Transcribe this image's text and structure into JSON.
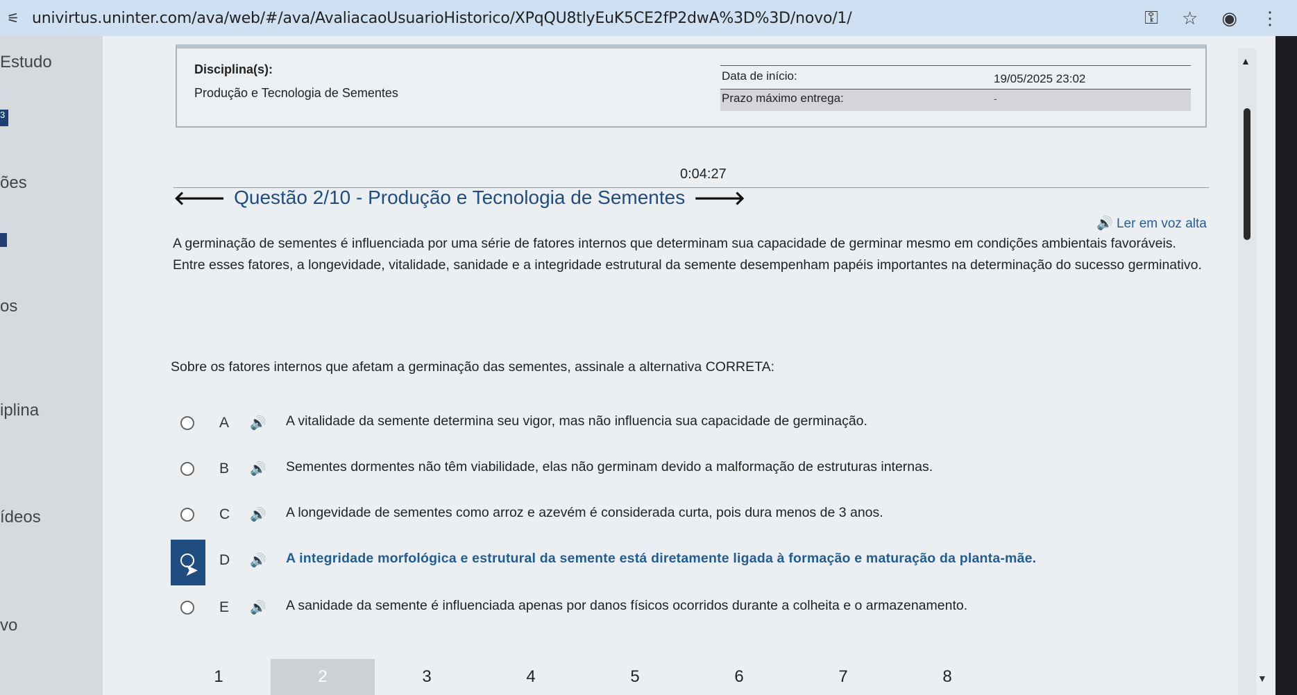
{
  "browser": {
    "url": "univirtus.uninter.com/ava/web/#/ava/AvaliacaoUsuarioHistorico/XPqQU8tlyEuK5CE2fP2dwA%3D%3D/novo/1/",
    "icons": [
      "key-icon",
      "star-icon",
      "profile-icon",
      "more-vert-icon"
    ]
  },
  "sidebar": {
    "items": [
      "Estudo",
      "ões",
      "os",
      "iplina",
      "ídeos",
      "vo"
    ],
    "badge": "3"
  },
  "info": {
    "discipline_label": "Disciplina(s):",
    "discipline_value": "Produção e Tecnologia de Sementes",
    "start_label": "Data de início:",
    "start_value": "19/05/2025 23:02",
    "due_label": "Prazo máximo entrega:",
    "due_value": "-"
  },
  "timer": "0:04:27",
  "question": {
    "title": "Questão 2/10 - Produção e Tecnologia de Sementes",
    "read_aloud": "Ler em voz alta",
    "stem": "A germinação de sementes é influenciada por uma série de fatores internos que determinam sua capacidade de germinar mesmo em condições ambientais favoráveis. Entre esses fatores, a longevidade, vitalidade, sanidade e a integridade estrutural da semente desempenham papéis importantes na determinação do sucesso germinativo.",
    "prompt": "Sobre os fatores internos que afetam a germinação das sementes, assinale a alternativa CORRETA:",
    "options": [
      {
        "letter": "A",
        "text": "A vitalidade da semente determina seu vigor, mas não influencia sua capacidade de germinação.",
        "selected": false
      },
      {
        "letter": "B",
        "text": "Sementes dormentes não têm viabilidade, elas não germinam devido a malformação de estruturas internas.",
        "selected": false
      },
      {
        "letter": "C",
        "text": "A longevidade de sementes como arroz e azevém é considerada curta, pois dura menos de 3 anos.",
        "selected": false
      },
      {
        "letter": "D",
        "text": "A integridade morfológica e estrutural da semente está diretamente ligada à formação e maturação da planta-mãe.",
        "selected": true
      },
      {
        "letter": "E",
        "text": "A sanidade da semente é influenciada apenas por danos físicos ocorridos durante a colheita e o armazenamento.",
        "selected": false
      }
    ]
  },
  "pager": {
    "pages": [
      "1",
      "2",
      "3",
      "4",
      "5",
      "6",
      "7",
      "8"
    ],
    "active": "2"
  }
}
